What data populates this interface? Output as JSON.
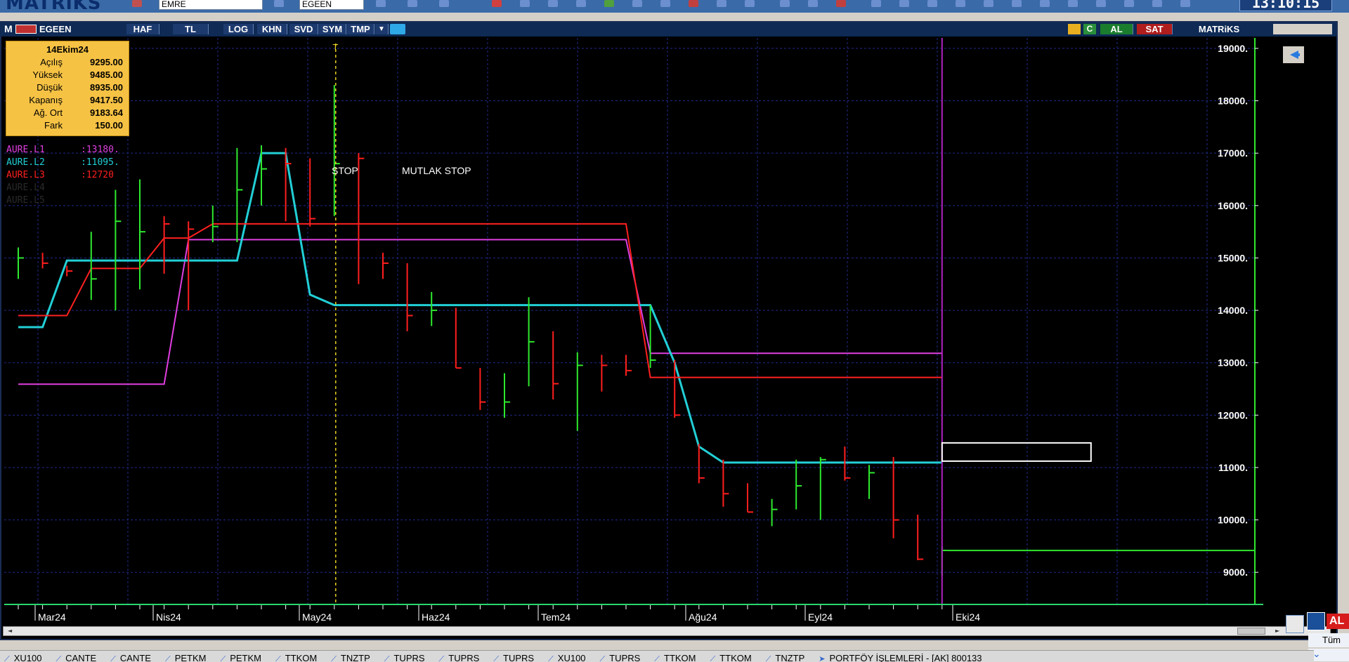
{
  "app": {
    "logo": "MATRiKS",
    "clock": "13:10:15"
  },
  "toolbar": {
    "symbol_input": "EMRE",
    "symbol_input2": "EGEEN"
  },
  "chart_header": {
    "menu": "M",
    "symbol": "EGEEN",
    "buttons": [
      "HAF",
      "TL",
      "LOG",
      "KHN",
      "SVD",
      "SYM",
      "TMP"
    ],
    "right": {
      "buy": "AL",
      "sell": "SAT",
      "brand": "MATRiKS"
    }
  },
  "infobox": {
    "date": "14Ekim24",
    "rows": [
      {
        "label": "Açılış",
        "value": "9295.00"
      },
      {
        "label": "Yüksek",
        "value": "9485.00"
      },
      {
        "label": "Düşük",
        "value": "8935.00"
      },
      {
        "label": "Kapanış",
        "value": "9417.50"
      },
      {
        "label": "Ağ. Ort",
        "value": "9183.64"
      },
      {
        "label": "Fark",
        "value": "150.00"
      }
    ]
  },
  "legend": [
    {
      "name": "AURE.L1",
      "value": ":13180.",
      "color": "#e03fe0"
    },
    {
      "name": "AURE.L2",
      "value": ":11095.",
      "color": "#22cfd6"
    },
    {
      "name": "AURE.L3",
      "value": ":12720",
      "color": "#ff2020"
    },
    {
      "name": "AURE.L4",
      "value": "",
      "color": "#2a2a2a"
    },
    {
      "name": "AURE.L5",
      "value": "",
      "color": "#2a2a2a"
    }
  ],
  "annotations": {
    "stop": "STOP",
    "mutlak_stop": "MUTLAK STOP",
    "marker": "T"
  },
  "right_panel": {
    "buy_short": "AL",
    "all_short": "Tüm"
  },
  "tabs": [
    "XU100",
    "CANTE",
    "CANTE",
    "PETKM",
    "PETKM",
    "TTKOM",
    "TNZTP",
    "TUPRS",
    "TUPRS",
    "TUPRS",
    "XU100",
    "TUPRS",
    "TTKOM",
    "TTKOM",
    "TNZTP",
    "PORTFÖY İŞLEMLERİ - [AK] 800133"
  ],
  "chart_data": {
    "type": "line",
    "symbol": "EGEEN",
    "x_ticks": [
      "Mar24",
      "Nis24",
      "May24",
      "Haz24",
      "Tem24",
      "Ağu24",
      "Eyl24",
      "Eki24"
    ],
    "y_ticks": [
      9000,
      10000,
      11000,
      12000,
      13000,
      14000,
      15000,
      16000,
      17000,
      18000,
      19000
    ],
    "y_tick_labels": [
      "9000.",
      "10000.",
      "11000.",
      "12000.",
      "13000.",
      "14000.",
      "15000.",
      "16000.",
      "17000.",
      "18000.",
      "19000."
    ],
    "ylim": [
      8400,
      19200
    ],
    "grid": true,
    "bars": [
      {
        "h": 15200,
        "l": 14600,
        "c": 15000,
        "up": true
      },
      {
        "h": 15100,
        "l": 14800,
        "c": 14900,
        "up": false
      },
      {
        "h": 14850,
        "l": 14650,
        "c": 14750,
        "up": false
      },
      {
        "h": 15500,
        "l": 14200,
        "c": 14600,
        "up": true
      },
      {
        "h": 16300,
        "l": 14000,
        "c": 15700,
        "up": true
      },
      {
        "h": 16500,
        "l": 14400,
        "c": 15500,
        "up": true
      },
      {
        "h": 15800,
        "l": 14700,
        "c": 15650,
        "up": false
      },
      {
        "h": 15700,
        "l": 14000,
        "c": 15550,
        "up": false
      },
      {
        "h": 16000,
        "l": 15300,
        "c": 15600,
        "up": true
      },
      {
        "h": 17100,
        "l": 15300,
        "c": 16300,
        "up": true
      },
      {
        "h": 17150,
        "l": 16000,
        "c": 16700,
        "up": true
      },
      {
        "h": 17100,
        "l": 15700,
        "c": 16800,
        "up": false
      },
      {
        "h": 16900,
        "l": 15600,
        "c": 15750,
        "up": false
      },
      {
        "h": 18300,
        "l": 15800,
        "c": 16800,
        "up": true
      },
      {
        "h": 17000,
        "l": 14500,
        "c": 16900,
        "up": false
      },
      {
        "h": 15100,
        "l": 14600,
        "c": 14900,
        "up": false
      },
      {
        "h": 14900,
        "l": 13600,
        "c": 13900,
        "up": false
      },
      {
        "h": 14350,
        "l": 13700,
        "c": 14000,
        "up": true
      },
      {
        "h": 14050,
        "l": 12900,
        "c": 12900,
        "up": false
      },
      {
        "h": 12900,
        "l": 12100,
        "c": 12250,
        "up": false
      },
      {
        "h": 12800,
        "l": 11950,
        "c": 12250,
        "up": true
      },
      {
        "h": 14250,
        "l": 12550,
        "c": 13400,
        "up": true
      },
      {
        "h": 13600,
        "l": 12300,
        "c": 12600,
        "up": false
      },
      {
        "h": 13200,
        "l": 11700,
        "c": 12950,
        "up": true
      },
      {
        "h": 13150,
        "l": 12450,
        "c": 12950,
        "up": false
      },
      {
        "h": 13150,
        "l": 12750,
        "c": 12850,
        "up": false
      },
      {
        "h": 14100,
        "l": 12900,
        "c": 13050,
        "up": true
      },
      {
        "h": 13050,
        "l": 11950,
        "c": 12000,
        "up": false
      },
      {
        "h": 11450,
        "l": 10700,
        "c": 10800,
        "up": false
      },
      {
        "h": 11150,
        "l": 10250,
        "c": 10500,
        "up": false
      },
      {
        "h": 10700,
        "l": 10150,
        "c": 10150,
        "up": false
      },
      {
        "h": 10400,
        "l": 9880,
        "c": 10200,
        "up": true
      },
      {
        "h": 11150,
        "l": 10200,
        "c": 10650,
        "up": true
      },
      {
        "h": 11200,
        "l": 10000,
        "c": 11150,
        "up": true
      },
      {
        "h": 11400,
        "l": 10750,
        "c": 10800,
        "up": false
      },
      {
        "h": 11050,
        "l": 10400,
        "c": 10900,
        "up": true
      },
      {
        "h": 11200,
        "l": 9650,
        "c": 10000,
        "up": false
      },
      {
        "h": 10100,
        "l": 9230,
        "c": 9250,
        "up": false
      },
      {
        "h": 9485,
        "l": 8935,
        "c": 9417.5,
        "up": true
      }
    ],
    "series": [
      {
        "name": "AURE.L1",
        "color": "#e03fe0",
        "values": [
          12590,
          12590,
          12590,
          12590,
          12590,
          12590,
          12590,
          15350,
          15350,
          15350,
          15350,
          15350,
          15350,
          15350,
          15350,
          15350,
          15350,
          15350,
          15350,
          15350,
          15350,
          15350,
          15350,
          15350,
          15350,
          15350,
          13180,
          13180,
          13180,
          13180,
          13180,
          13180,
          13180,
          13180,
          13180,
          13180,
          13180,
          13180,
          13180
        ]
      },
      {
        "name": "AURE.L2",
        "color": "#22cfd6",
        "values": [
          13680,
          13680,
          14950,
          14950,
          14950,
          14950,
          14950,
          14950,
          14950,
          14950,
          17000,
          17000,
          14300,
          14100,
          14100,
          14100,
          14100,
          14100,
          14100,
          14100,
          14100,
          14100,
          14100,
          14100,
          14100,
          14100,
          14100,
          13000,
          11400,
          11095,
          11095,
          11095,
          11095,
          11095,
          11095,
          11095,
          11095,
          11095,
          11095
        ]
      },
      {
        "name": "AURE.L3",
        "color": "#ff2020",
        "values": [
          13900,
          13900,
          13900,
          14800,
          14800,
          14800,
          15380,
          15380,
          15650,
          15650,
          15650,
          15650,
          15650,
          15650,
          15650,
          15650,
          15650,
          15650,
          15650,
          15650,
          15650,
          15650,
          15650,
          15650,
          15650,
          15650,
          12720,
          12720,
          12720,
          12720,
          12720,
          12720,
          12720,
          12720,
          12720,
          12720,
          12720,
          12720,
          12720
        ]
      }
    ],
    "current_price": 9417.5
  }
}
